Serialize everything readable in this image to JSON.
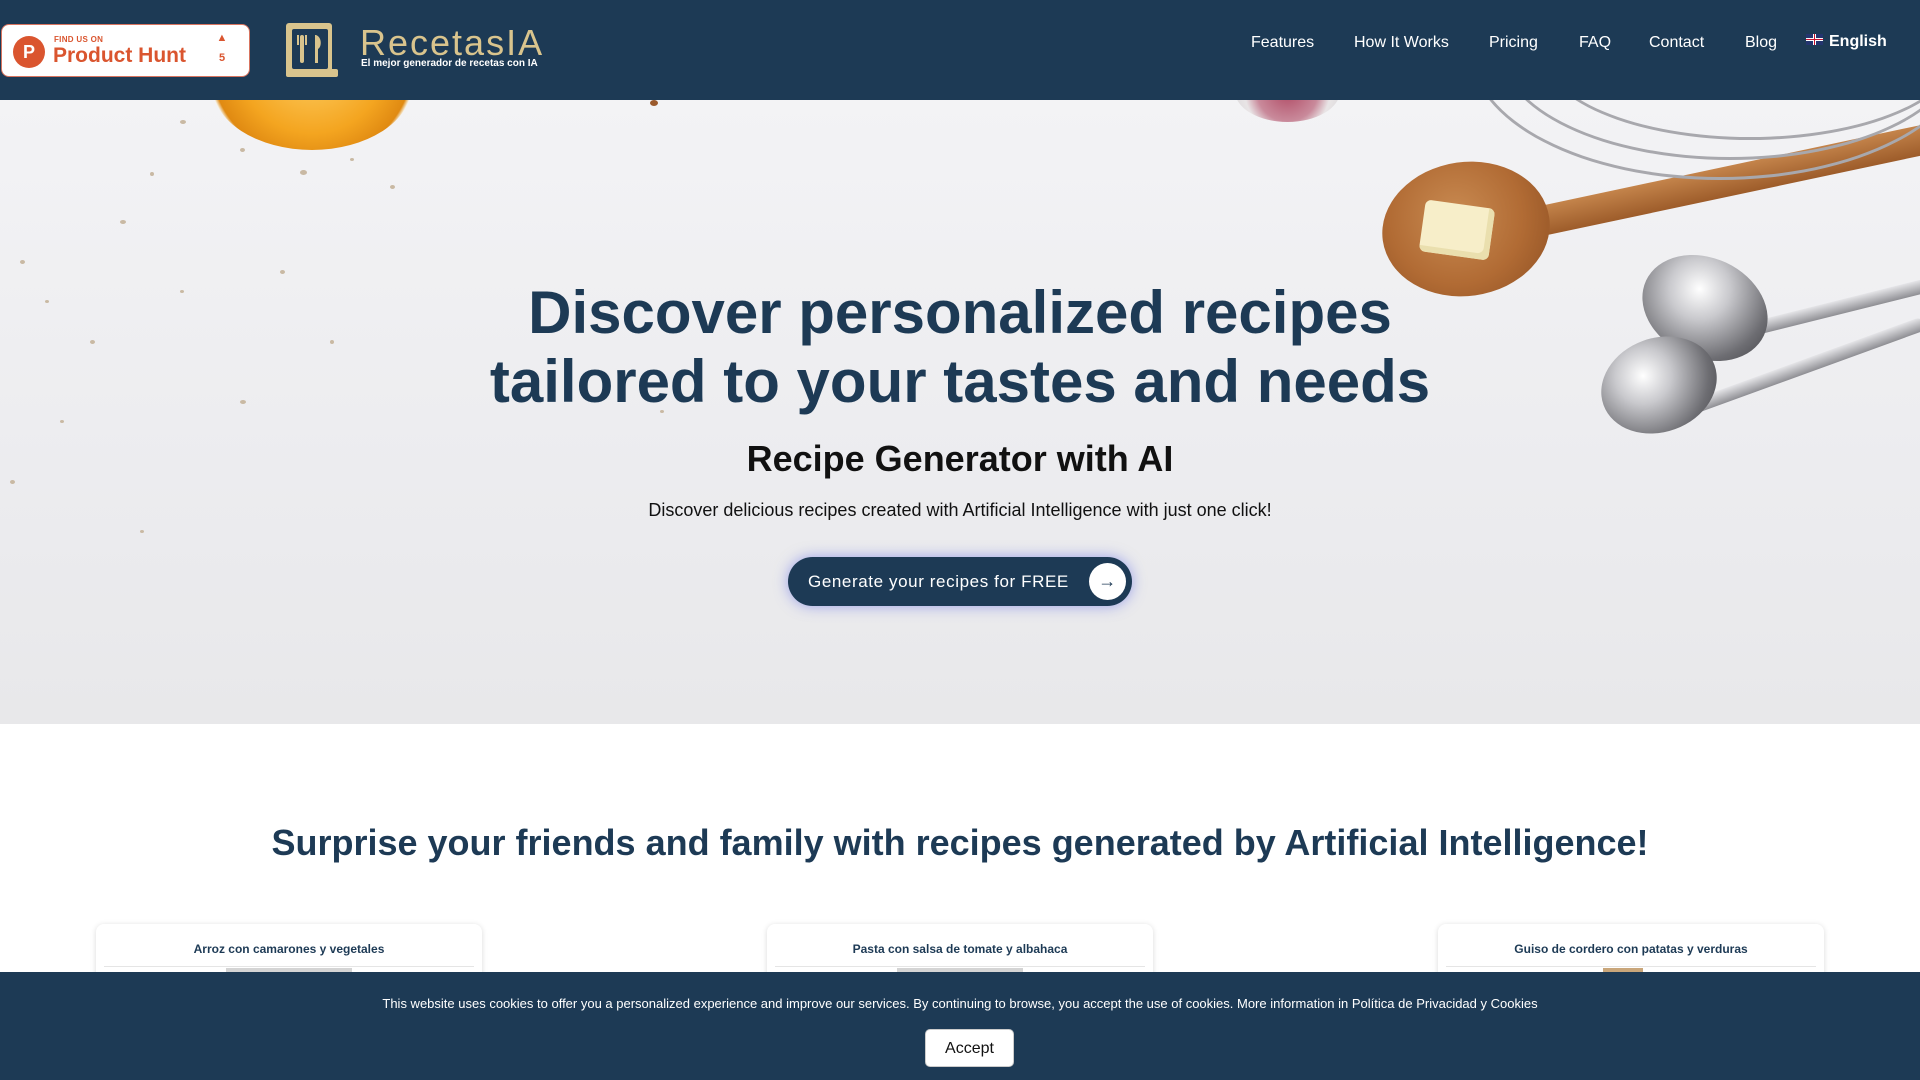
{
  "product_hunt": {
    "small_label": "FIND US ON",
    "name": "Product Hunt",
    "upvote_arrow": "▲",
    "upvotes": "5",
    "logo_letter": "P"
  },
  "brand": {
    "name": "RecetasIA",
    "tagline": "El mejor generador de recetas con IA",
    "logo_color": "#d9c48d"
  },
  "nav": {
    "links": [
      "Features",
      "How It Works",
      "Pricing",
      "FAQ",
      "Contact",
      "Blog"
    ],
    "language": "English"
  },
  "hero": {
    "title": "Discover personalized recipes tailored to your tastes and needs",
    "subtitle": "Recipe Generator with AI",
    "description": "Discover delicious recipes created with Artificial Intelligence with just one click!",
    "cta_label": "Generate your recipes for FREE",
    "cta_icon": "arrow-right-icon"
  },
  "section": {
    "title": "Surprise your friends and family with recipes generated by Artificial Intelligence!",
    "cards": [
      {
        "title": "Arroz con camarones y vegetales"
      },
      {
        "title": "Pasta con salsa de tomate y albahaca"
      },
      {
        "title": "Guiso de cordero con patatas y verduras"
      }
    ]
  },
  "cookie": {
    "text": "This website uses cookies to offer you a personalized experience and improve our services. By continuing to browse, you accept the use of cookies. More information in Política de Privacidad y Cookies",
    "accept_label": "Accept"
  },
  "colors": {
    "primary": "#1d3a55",
    "product_hunt": "#da552f",
    "accent_gold": "#d9c48d"
  }
}
